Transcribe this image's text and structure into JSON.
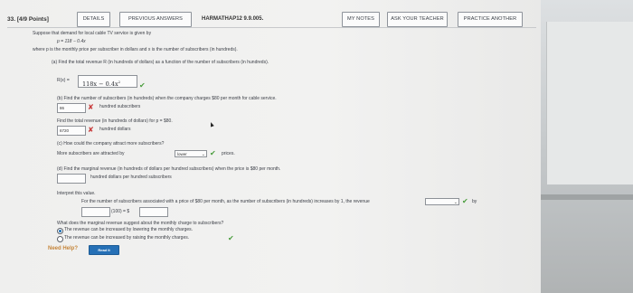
{
  "header": {
    "question_number": "33. [4/9 Points]",
    "details_button": "DETAILS",
    "previous_answers_button": "PREVIOUS ANSWERS",
    "textbook_code": "HARMATHAP12 9.9.005.",
    "my_notes_button": "MY NOTES",
    "ask_teacher_button": "ASK YOUR TEACHER",
    "practice_another_button": "PRACTICE ANOTHER"
  },
  "intro": {
    "line1": "Suppose that demand for local cable TV service is given by",
    "equation": "p = 118 − 0.4x",
    "line2": "where p is the monthly price per subscriber in dollars and x is the number of subscribers (in hundreds)."
  },
  "part_a": {
    "prompt": "(a) Find the total revenue R (in hundreds of dollars) as a function of the number of subscribers (in hundreds).",
    "label": "R(x) =",
    "answer": "118x − 0.4x",
    "answer_exp": "2"
  },
  "part_b": {
    "prompt": "(b) Find the number of subscribers (in hundreds) when the company charges $80 per month for cable service.",
    "answer1": "86",
    "unit1": "hundred subscribers",
    "prompt2": "Find the total revenue (in hundreds of dollars) for p = $80.",
    "answer2": "6720",
    "unit2": "hundred dollars"
  },
  "part_c": {
    "prompt": "(c) How could the company attract more subscribers?",
    "sentence_start": "More subscribers are attracted by",
    "selected": "lower",
    "sentence_end": "prices."
  },
  "part_d": {
    "prompt": "(d) Find the marginal revenue (in hundreds of dollars per hundred subscribers) when the price is $80 per month.",
    "unit": "hundred dollars per hundred subscribers",
    "answer": ""
  },
  "interpret": {
    "heading": "Interpret this value.",
    "sentence": "For the number of subscribers associated with a price of $80 per month, as the number of subscribers (in hundreds) increases by 1, the revenue",
    "selected": "",
    "sentence_end": "by",
    "line2_mid": "(100) = $",
    "answer": ""
  },
  "marginal_question": {
    "prompt": "What does the marginal revenue suggest about the monthly charge to subscribers?",
    "options": [
      "The revenue can be increased by lowering the monthly charges.",
      "The revenue can be increased by raising the monthly charges."
    ],
    "selected_index": 0
  },
  "help": {
    "label": "Need Help?",
    "button": "Read It"
  },
  "colors": {
    "correct": "#4a9d3d",
    "incorrect": "#c83a3a",
    "help_button": "#2570b6"
  }
}
